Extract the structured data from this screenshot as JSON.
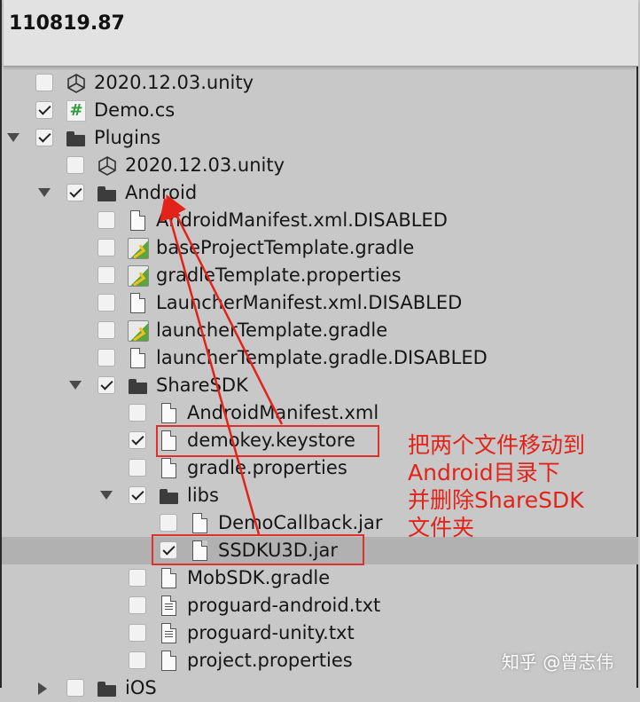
{
  "header": {
    "title": "110819.87"
  },
  "tree": [
    {
      "label": "2020.12.03.unity",
      "icon": "unity-icon",
      "checked": false,
      "indent": 0,
      "arrow": "none"
    },
    {
      "label": "Demo.cs",
      "icon": "csharp-icon",
      "checked": true,
      "indent": 0,
      "arrow": "none"
    },
    {
      "label": "Plugins",
      "icon": "folder-icon",
      "checked": true,
      "indent": 0,
      "arrow": "down"
    },
    {
      "label": "2020.12.03.unity",
      "icon": "unity-icon",
      "checked": false,
      "indent": 1,
      "arrow": "none"
    },
    {
      "label": "Android",
      "icon": "folder-icon",
      "checked": true,
      "indent": 1,
      "arrow": "down"
    },
    {
      "label": "AndroidManifest.xml.DISABLED",
      "icon": "file-icon",
      "checked": false,
      "indent": 2,
      "arrow": "none"
    },
    {
      "label": "baseProjectTemplate.gradle",
      "icon": "gradle-icon",
      "checked": false,
      "indent": 2,
      "arrow": "none"
    },
    {
      "label": "gradleTemplate.properties",
      "icon": "gradle-icon",
      "checked": false,
      "indent": 2,
      "arrow": "none"
    },
    {
      "label": "LauncherManifest.xml.DISABLED",
      "icon": "file-icon",
      "checked": false,
      "indent": 2,
      "arrow": "none"
    },
    {
      "label": "launcherTemplate.gradle",
      "icon": "gradle-icon",
      "checked": false,
      "indent": 2,
      "arrow": "none"
    },
    {
      "label": "launcherTemplate.gradle.DISABLED",
      "icon": "file-icon",
      "checked": false,
      "indent": 2,
      "arrow": "none"
    },
    {
      "label": "ShareSDK",
      "icon": "folder-icon",
      "checked": true,
      "indent": 2,
      "arrow": "down"
    },
    {
      "label": "AndroidManifest.xml",
      "icon": "file-icon",
      "checked": false,
      "indent": 3,
      "arrow": "none"
    },
    {
      "label": "demokey.keystore",
      "icon": "file-icon",
      "checked": true,
      "indent": 3,
      "arrow": "none"
    },
    {
      "label": "gradle.properties",
      "icon": "file-icon",
      "checked": false,
      "indent": 3,
      "arrow": "none"
    },
    {
      "label": "libs",
      "icon": "folder-icon",
      "checked": true,
      "indent": 3,
      "arrow": "down"
    },
    {
      "label": "DemoCallback.jar",
      "icon": "file-icon",
      "checked": false,
      "indent": 4,
      "arrow": "none"
    },
    {
      "label": "SSDKU3D.jar",
      "icon": "file-icon",
      "checked": true,
      "indent": 4,
      "arrow": "none",
      "selected": true
    },
    {
      "label": "MobSDK.gradle",
      "icon": "file-icon",
      "checked": false,
      "indent": 3,
      "arrow": "none"
    },
    {
      "label": "proguard-android.txt",
      "icon": "text-file-icon",
      "checked": false,
      "indent": 3,
      "arrow": "none"
    },
    {
      "label": "proguard-unity.txt",
      "icon": "text-file-icon",
      "checked": false,
      "indent": 3,
      "arrow": "none"
    },
    {
      "label": "project.properties",
      "icon": "file-icon",
      "checked": false,
      "indent": 3,
      "arrow": "none"
    },
    {
      "label": "iOS",
      "icon": "folder-icon",
      "checked": false,
      "indent": 1,
      "arrow": "right"
    }
  ],
  "annotation": {
    "lines": [
      "把两个文件移动到",
      "Android目录下",
      "并删除ShareSDK",
      "文件夹"
    ],
    "color": "#e2231a"
  },
  "watermark": "知乎 @曾志伟"
}
